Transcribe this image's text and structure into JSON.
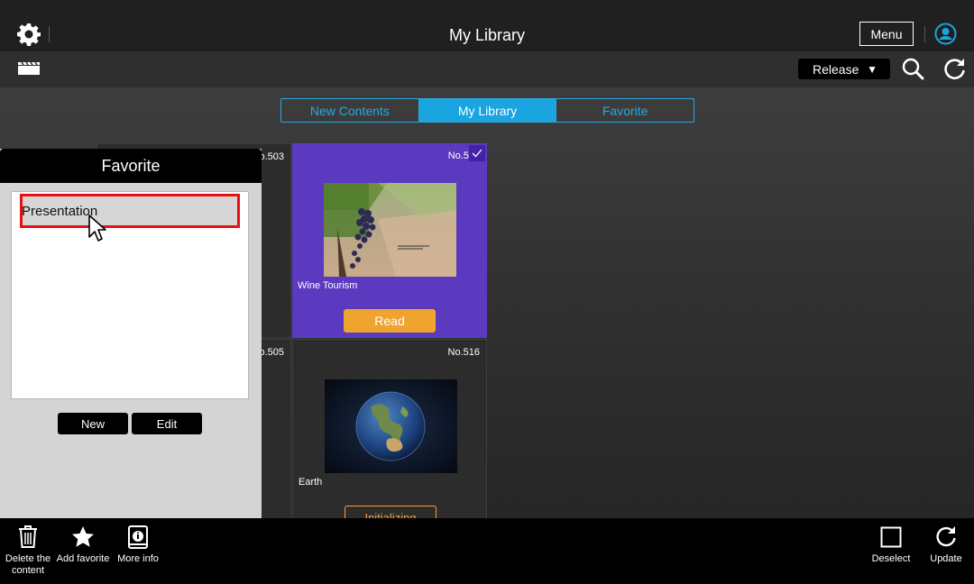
{
  "header": {
    "title": "My Library",
    "menu_label": "Menu",
    "release_label": "Release"
  },
  "tabs": [
    {
      "label": "New Contents",
      "active": false
    },
    {
      "label": "My Library",
      "active": true
    },
    {
      "label": "Favorite",
      "active": false
    }
  ],
  "cards": [
    {
      "number": "o.503",
      "name": "",
      "button": "",
      "selected": false
    },
    {
      "number": "No.5",
      "name": "Wine Tourism",
      "button": "Read",
      "selected": true
    },
    {
      "number": "o.505",
      "name": "",
      "button": "",
      "selected": false
    },
    {
      "number": "No.516",
      "name": "Earth",
      "button": "Initializing",
      "selected": false
    }
  ],
  "favorite_panel": {
    "title": "Favorite",
    "items": [
      "Presentation"
    ],
    "new_label": "New",
    "edit_label": "Edit"
  },
  "bottom_bar": {
    "delete": "Delete the content",
    "add_favorite": "Add favorite",
    "more_info": "More info",
    "deselect": "Deselect",
    "update": "Update"
  },
  "colors": {
    "accent": "#1aa4e0",
    "selected_card": "#5c3ac0",
    "read_button": "#f0a430",
    "highlight": "#e81010"
  }
}
